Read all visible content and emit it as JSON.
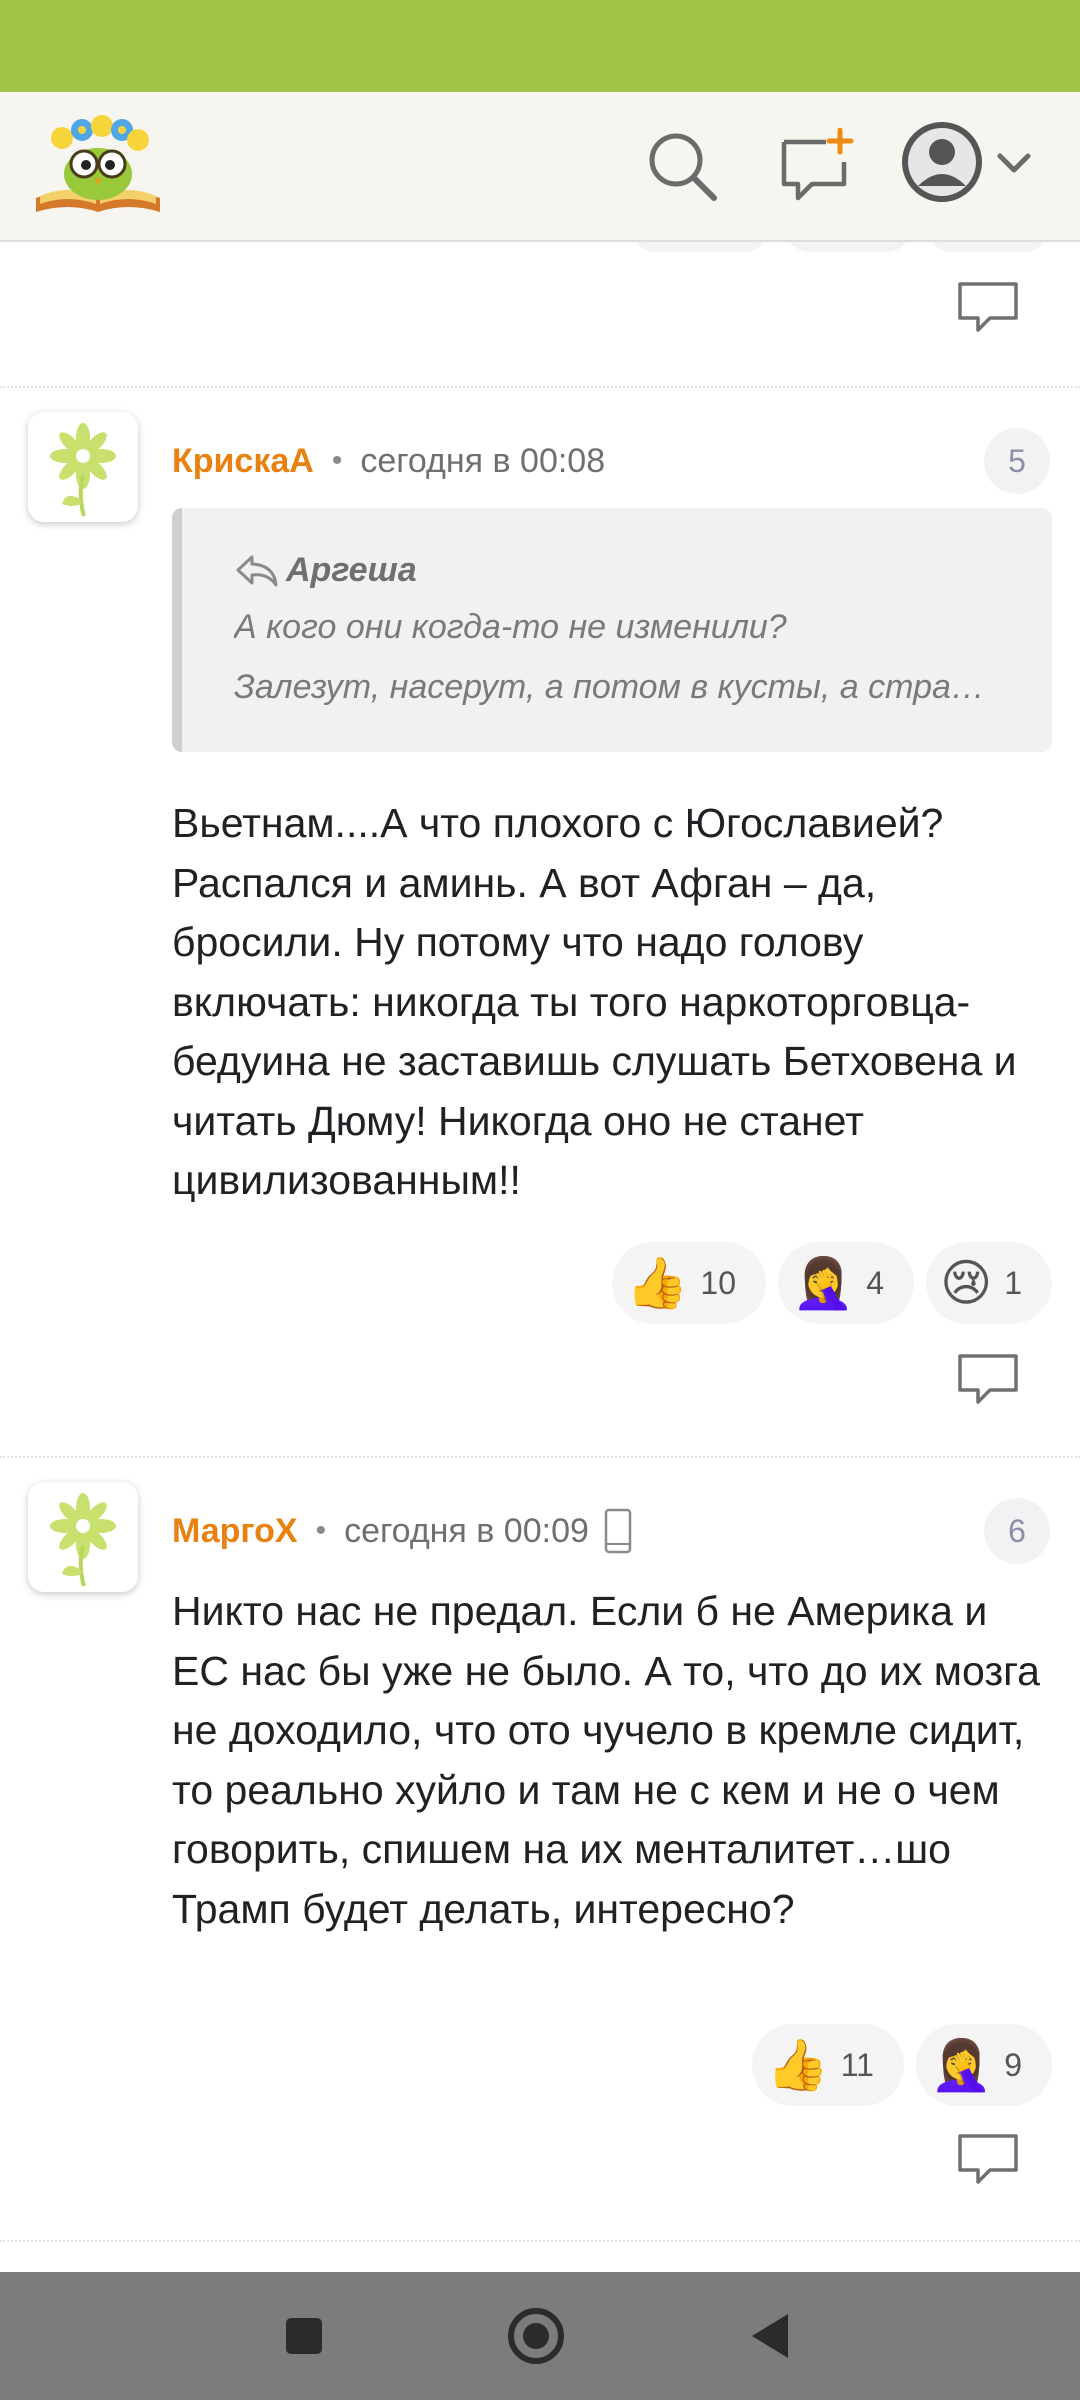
{
  "app": {
    "logo": "site-logo-flower-owl",
    "icons": [
      "search-icon",
      "new-post-icon",
      "avatar-icon",
      "chevron-down-icon"
    ]
  },
  "comments": [
    {
      "author": "КрискаА",
      "time": "сегодня в 00:08",
      "number": "5",
      "quote": {
        "author": "Аргеша",
        "lines": [
          "А кого они когда-то не изменили?",
          "Залезут,  насерут,  а  потом  в  кусты,  а  стра…"
        ]
      },
      "text": "Вьетнам....А что плохого с Югославией? Распался и аминь. А вот Афган – да, бросили. Ну потому что надо голову включать: никогда ты того наркоторговца-бедуина не заставишь слушать Бетховена и читать Дюму! Никогда оно не станет цивилизованным!!",
      "reactions": [
        {
          "emoji": "👍",
          "count": "10"
        },
        {
          "emoji": "🤦‍♀️",
          "count": "4"
        },
        {
          "emoji": "😢",
          "count": "1"
        }
      ]
    },
    {
      "author": "МаргоХ",
      "time": "сегодня в 00:09",
      "device": "phone-icon",
      "number": "6",
      "text": "Никто нас не предал. Если б не Америка и ЕС нас бы уже не было. А то, что до их мозга не доходило, что ото чучело в кремле сидит, то реально хуйло и там не с кем и не о чем говорить, спишем на их менталитет…шо Трамп будет делать, интересно?",
      "reactions": [
        {
          "emoji": "👍",
          "count": "11"
        },
        {
          "emoji": "🤦‍♀️",
          "count": "9"
        }
      ]
    }
  ],
  "colors": {
    "status_bar": "#9fc447",
    "header_bg": "#f6f5f0",
    "author": "#e8810f",
    "nav_bar": "#7c7c7c"
  }
}
